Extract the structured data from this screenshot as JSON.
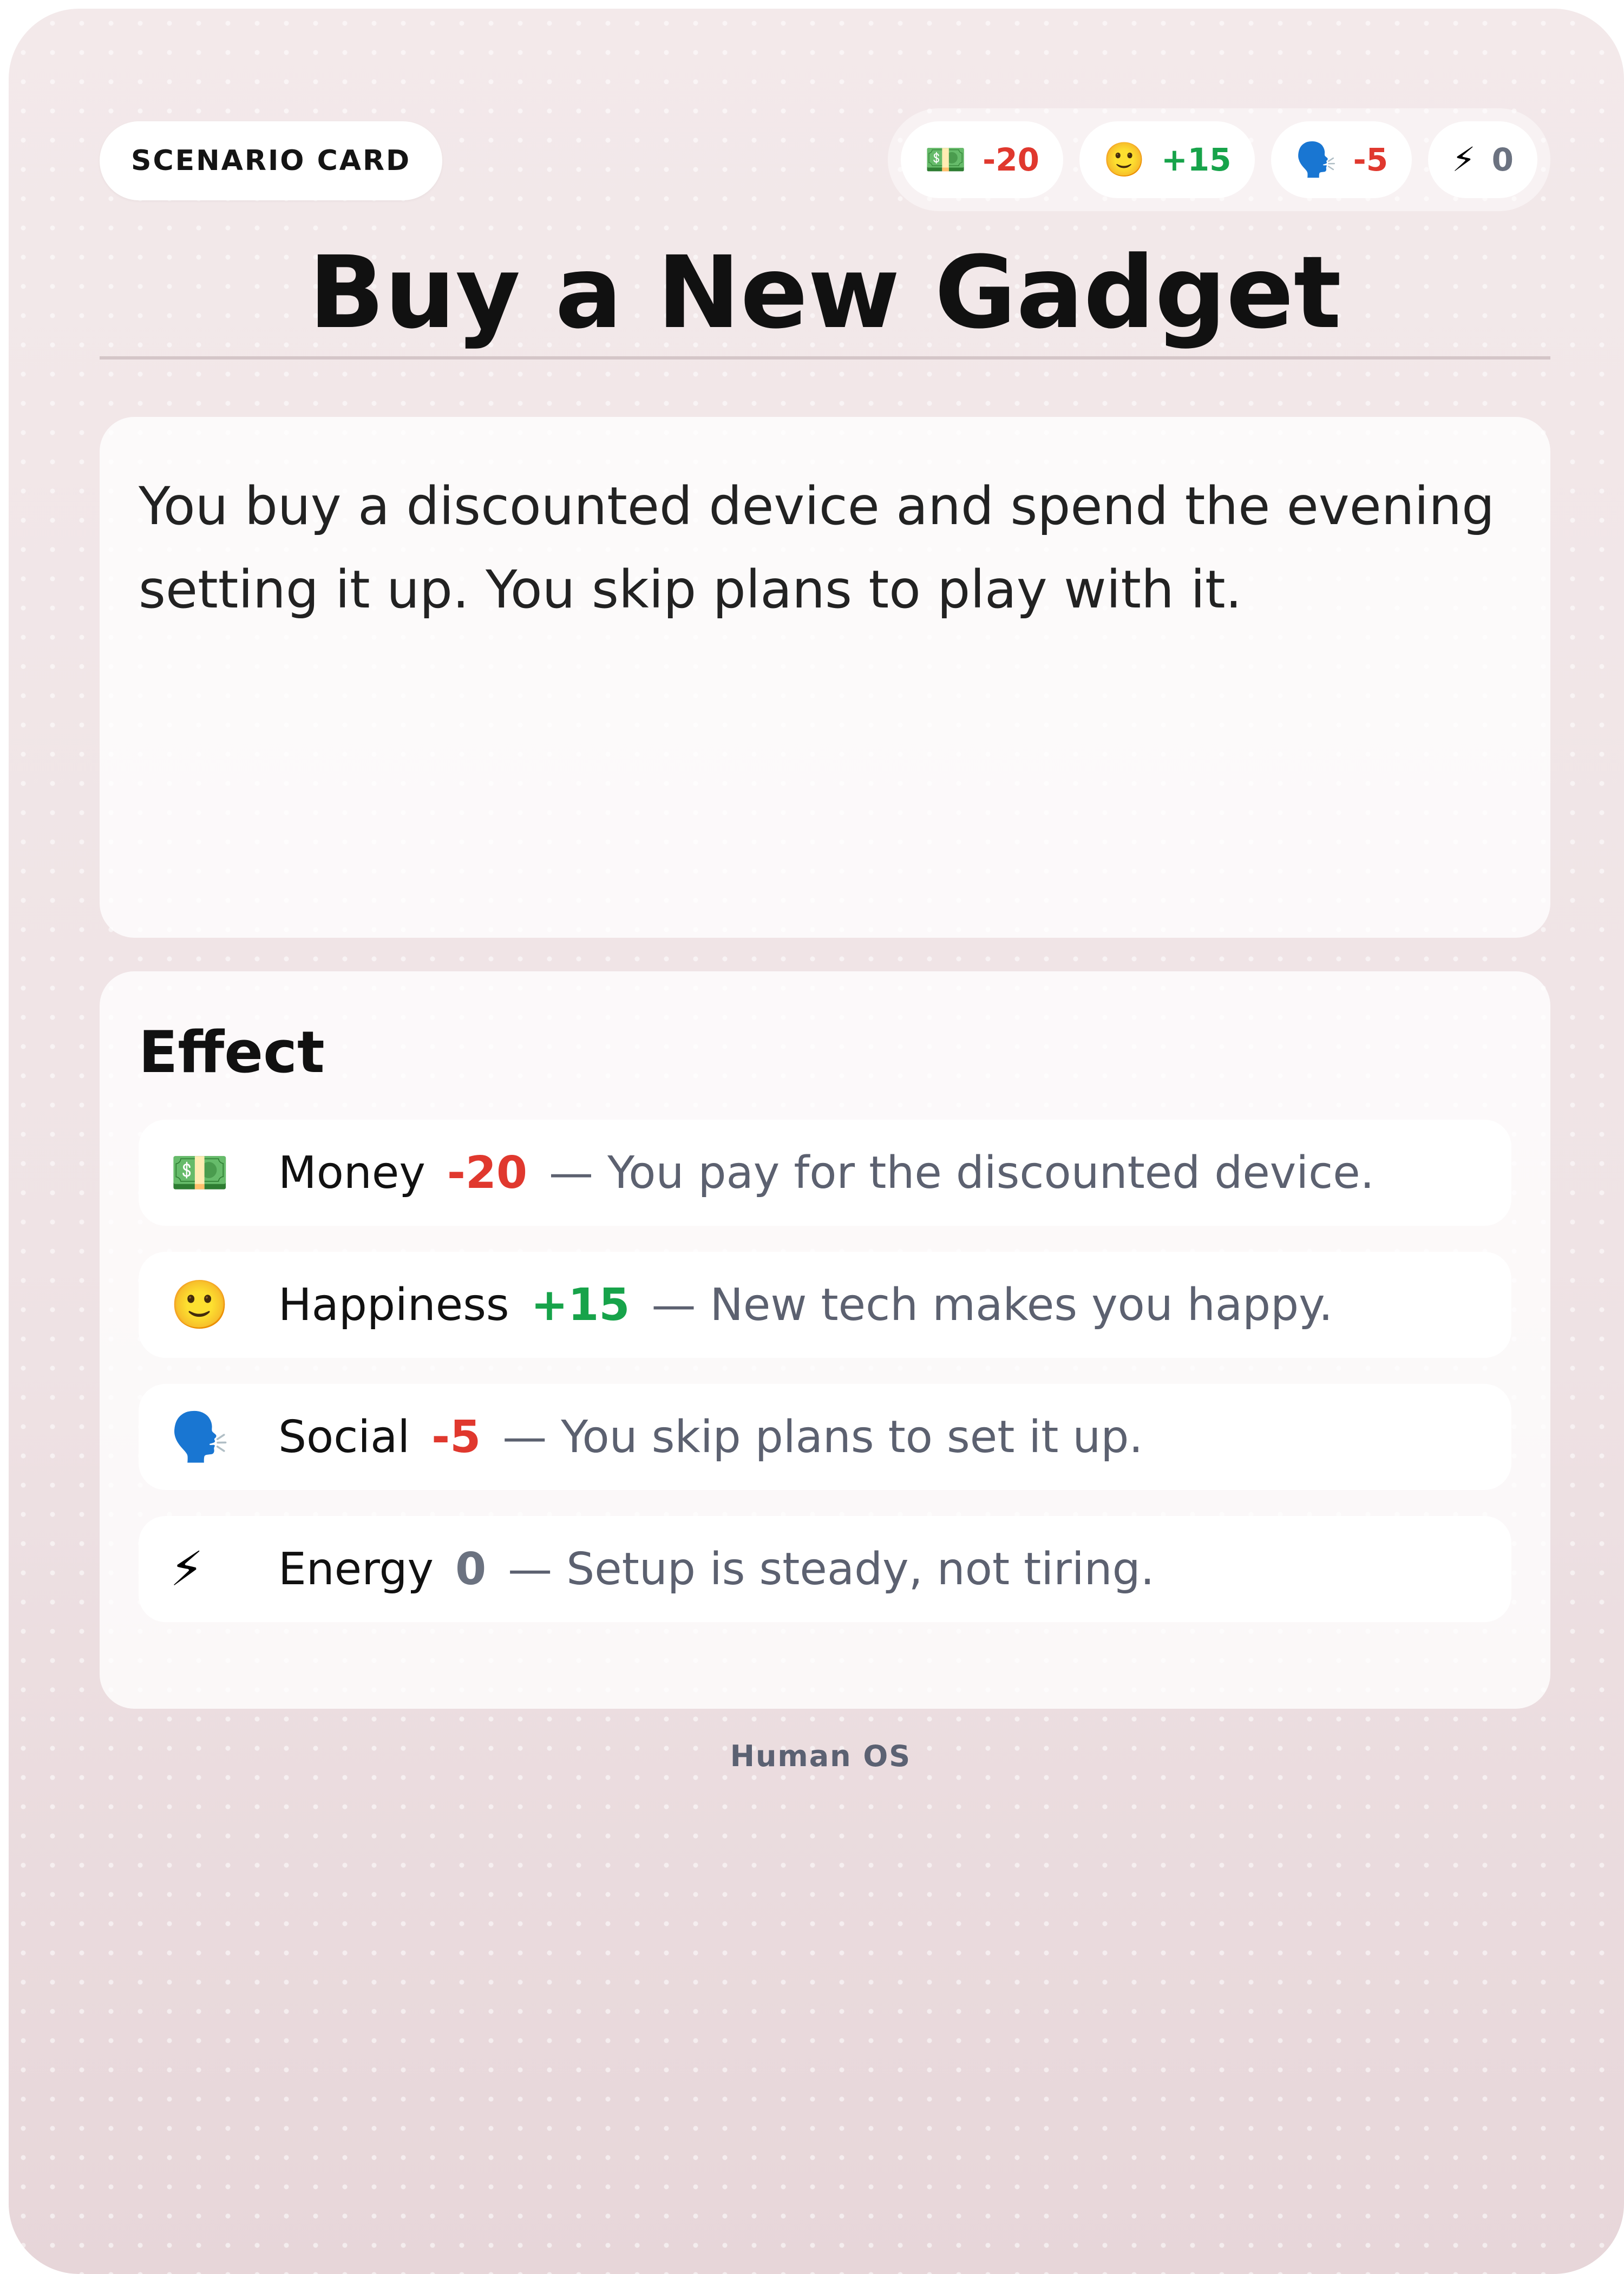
{
  "card": {
    "badge": "SCENARIO CARD",
    "title": "Buy a New Gadget",
    "description": "You buy a discounted device and spend the evening setting it up. You skip plans to play with it.",
    "effect_heading": "Effect",
    "footer": "Human OS"
  },
  "stats": [
    {
      "icon": "money-icon",
      "glyph": "💵",
      "value": "-20",
      "tone": "negative"
    },
    {
      "icon": "happy-face-icon",
      "glyph": "🙂",
      "value": "+15",
      "tone": "positive"
    },
    {
      "icon": "speaking-head-icon",
      "glyph": "🗣️",
      "value": "-5",
      "tone": "negative"
    },
    {
      "icon": "lightning-icon",
      "glyph": "⚡",
      "value": "0",
      "tone": "neutral"
    }
  ],
  "effects": [
    {
      "icon": "money-icon",
      "glyph": "💵",
      "label": "Money",
      "value": "-20",
      "tone": "negative",
      "desc": "— You pay for the discounted device."
    },
    {
      "icon": "happy-face-icon",
      "glyph": "🙂",
      "label": "Happiness",
      "value": "+15",
      "tone": "positive",
      "desc": "— New tech makes you happy."
    },
    {
      "icon": "speaking-head-icon",
      "glyph": "🗣️",
      "label": "Social",
      "value": "-5",
      "tone": "negative",
      "desc": "— You skip plans to set it up."
    },
    {
      "icon": "lightning-icon",
      "glyph": "⚡",
      "label": "Energy",
      "value": "0",
      "tone": "neutral",
      "desc": "— Setup is steady, not tiring."
    }
  ],
  "colors": {
    "negative": "#e0382e",
    "positive": "#17a34a",
    "neutral": "#6b7280",
    "card_background": "#efe2e4"
  }
}
